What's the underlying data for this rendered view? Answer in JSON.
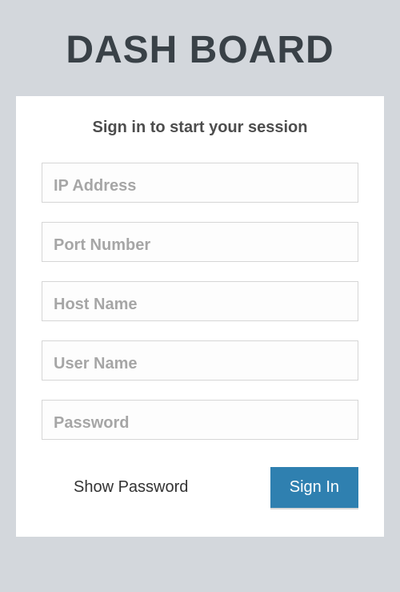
{
  "header": {
    "title": "DASH BOARD"
  },
  "login": {
    "heading": "Sign in to start your session",
    "fields": {
      "ip": {
        "placeholder": "IP Address",
        "value": ""
      },
      "port": {
        "placeholder": "Port Number",
        "value": ""
      },
      "host": {
        "placeholder": "Host Name",
        "value": ""
      },
      "user": {
        "placeholder": "User Name",
        "value": ""
      },
      "password": {
        "placeholder": "Password",
        "value": ""
      }
    },
    "show_password_label": "Show Password",
    "signin_label": "Sign In"
  }
}
